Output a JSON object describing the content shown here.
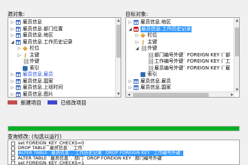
{
  "source_panel": {
    "label": "源对象:",
    "rows": [
      {
        "indent": 0,
        "arrow": "▷",
        "icon": "table",
        "text": "雇员信息"
      },
      {
        "indent": 0,
        "arrow": "▷",
        "icon": "table",
        "text": "雇员信息.部门位置"
      },
      {
        "indent": 0,
        "arrow": "▷",
        "icon": "table",
        "text": "雇员信息.地区"
      },
      {
        "indent": 0,
        "arrow": "◢",
        "icon": "table",
        "text": "雇员信息.工作历史记录"
      },
      {
        "indent": 1,
        "arrow": "▷",
        "icon": "col",
        "text": "栏位"
      },
      {
        "indent": 1,
        "arrow": "▷",
        "icon": "key",
        "text": "主键"
      },
      {
        "indent": 1,
        "arrow": "",
        "icon": "fk",
        "text": "外键"
      },
      {
        "indent": 1,
        "arrow": "",
        "icon": "idx",
        "text": "索引"
      },
      {
        "indent": 0,
        "arrow": "▷",
        "icon": "table",
        "text": "雇员信息.雇员",
        "link": true
      },
      {
        "indent": 0,
        "arrow": "▷",
        "icon": "table",
        "text": "雇员信息.国家"
      },
      {
        "indent": 0,
        "arrow": "▷",
        "icon": "table",
        "text": "雇员信息.上班时间"
      },
      {
        "indent": 0,
        "arrow": "▷",
        "icon": "table",
        "text": "雇员信息.图片"
      }
    ]
  },
  "target_panel": {
    "label": "目标对象:",
    "rows": [
      {
        "indent": 0,
        "arrow": "▷",
        "icon": "table",
        "text": "雇员信息.地区"
      },
      {
        "indent": 0,
        "arrow": "◢",
        "icon": "table-red",
        "text": "雇员信息.工作历史记录",
        "selected": true
      },
      {
        "indent": 1,
        "arrow": "▷",
        "icon": "col",
        "text": "栏位"
      },
      {
        "indent": 1,
        "arrow": "▷",
        "icon": "key",
        "text": "主键"
      },
      {
        "indent": 1,
        "arrow": "◢",
        "icon": "fk",
        "text": "外键"
      },
      {
        "indent": 2,
        "arrow": "",
        "icon": "fk",
        "text": "部门编号外键` FOREIGN KEY (`部"
      },
      {
        "indent": 2,
        "arrow": "",
        "icon": "fk",
        "text": "工作编号外键` FOREIGN KEY (`工"
      },
      {
        "indent": 2,
        "arrow": "",
        "icon": "fk",
        "text": "雇员编号外键` FOREIGN KEY (`雇"
      },
      {
        "indent": 1,
        "arrow": "",
        "icon": "idx",
        "text": "索引"
      },
      {
        "indent": 0,
        "arrow": "▷",
        "icon": "table",
        "text": "雇员信息.雇员"
      },
      {
        "indent": 0,
        "arrow": "▷",
        "icon": "table",
        "text": "雇员信息.国家"
      }
    ]
  },
  "legend": {
    "new_label": "新建项目",
    "new_color": "#c0504d",
    "changed_label": "已修改项目",
    "changed_color": "#3f48cc"
  },
  "progress": {
    "percent": 100,
    "color": "#06b025"
  },
  "query": {
    "label": "查询修改: (勾选以运行)",
    "rows": [
      {
        "text": "set FOREIGN_KEY_CHECKS=0",
        "selected": false
      },
      {
        "text": "DROP TABLE `雇员信息`.`工作`",
        "selected": false
      },
      {
        "text": "ALTER TABLE `雇员信息`.`工作历史记录` DROP FOREIGN KEY `工作编号外键`",
        "selected": true
      },
      {
        "text": "ALTER TABLE `雇员信息`.`部门` DROP FOREIGN KEY `部门编号外键`",
        "selected": false
      },
      {
        "text": "set FOREIGN_KEY_CHECKS=1",
        "selected": false
      }
    ]
  }
}
